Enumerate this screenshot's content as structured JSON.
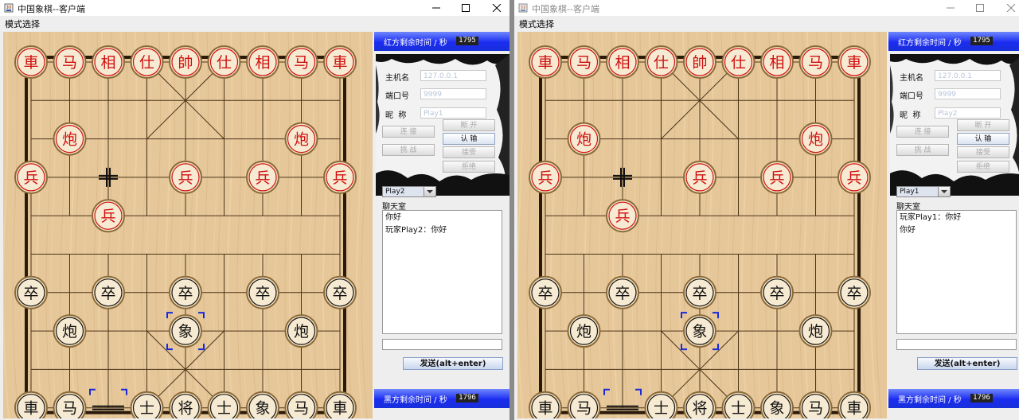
{
  "windows": [
    {
      "title": "中国象棋--客户端",
      "menu": "模式选择",
      "red_timer": {
        "label": "红方剩余时间 / 秒",
        "value": "1795"
      },
      "black_timer": {
        "label": "黑方剩余时间 / 秒",
        "value": "1796"
      },
      "host_label": "主机名",
      "host_value": "127.0.0.1",
      "port_label": "端口号",
      "port_value": "9999",
      "nick_label": "昵  称",
      "nick_value": "Play1",
      "buttons": {
        "connect": "连 接",
        "disconnect": "断 开",
        "challenge": "挑 战",
        "resign": "认 输",
        "accept": "接受",
        "reject": "拒绝"
      },
      "opponent_select": "Play2",
      "chat_title": "聊天室",
      "chat_lines": [
        "你好",
        "玩家Play2：你好"
      ],
      "send_button": "发送(alt+enter)"
    },
    {
      "title": "中国象棋--客户端",
      "menu": "模式选择",
      "red_timer": {
        "label": "红方剩余时间 / 秒",
        "value": "1795"
      },
      "black_timer": {
        "label": "黑方剩余时间 / 秒",
        "value": "1796"
      },
      "host_label": "主机名",
      "host_value": "127.0.0.1",
      "port_label": "端口号",
      "port_value": "9999",
      "nick_label": "昵  称",
      "nick_value": "Play2",
      "buttons": {
        "connect": "连 接",
        "disconnect": "断 开",
        "challenge": "挑 战",
        "resign": "认 输",
        "accept": "接受",
        "reject": "拒绝"
      },
      "opponent_select": "Play1",
      "chat_title": "聊天室",
      "chat_lines": [
        "玩家Play1：你好",
        "你好"
      ],
      "send_button": "发送(alt+enter)"
    }
  ],
  "board": {
    "colors": {
      "wood": "#e6c79a",
      "red_piece": "#d01010",
      "black_piece": "#111111",
      "selection": "#1a2ad8"
    },
    "pieces": [
      {
        "side": "red",
        "label": "車",
        "file": 0,
        "rank": 0
      },
      {
        "side": "red",
        "label": "马",
        "file": 1,
        "rank": 0
      },
      {
        "side": "red",
        "label": "相",
        "file": 2,
        "rank": 0
      },
      {
        "side": "red",
        "label": "仕",
        "file": 3,
        "rank": 0
      },
      {
        "side": "red",
        "label": "帥",
        "file": 4,
        "rank": 0
      },
      {
        "side": "red",
        "label": "仕",
        "file": 5,
        "rank": 0
      },
      {
        "side": "red",
        "label": "相",
        "file": 6,
        "rank": 0
      },
      {
        "side": "red",
        "label": "马",
        "file": 7,
        "rank": 0
      },
      {
        "side": "red",
        "label": "車",
        "file": 8,
        "rank": 0
      },
      {
        "side": "red",
        "label": "炮",
        "file": 1,
        "rank": 2
      },
      {
        "side": "red",
        "label": "炮",
        "file": 7,
        "rank": 2
      },
      {
        "side": "red",
        "label": "兵",
        "file": 0,
        "rank": 3
      },
      {
        "side": "red",
        "label": "兵",
        "file": 4,
        "rank": 3
      },
      {
        "side": "red",
        "label": "兵",
        "file": 6,
        "rank": 3
      },
      {
        "side": "red",
        "label": "兵",
        "file": 8,
        "rank": 3
      },
      {
        "side": "red",
        "label": "兵",
        "file": 2,
        "rank": 4
      },
      {
        "side": "black",
        "label": "卒",
        "file": 0,
        "rank": 6
      },
      {
        "side": "black",
        "label": "卒",
        "file": 2,
        "rank": 6
      },
      {
        "side": "black",
        "label": "卒",
        "file": 4,
        "rank": 6
      },
      {
        "side": "black",
        "label": "卒",
        "file": 6,
        "rank": 6
      },
      {
        "side": "black",
        "label": "卒",
        "file": 8,
        "rank": 6
      },
      {
        "side": "black",
        "label": "炮",
        "file": 1,
        "rank": 7
      },
      {
        "side": "black",
        "label": "象",
        "file": 4,
        "rank": 7
      },
      {
        "side": "black",
        "label": "炮",
        "file": 7,
        "rank": 7
      },
      {
        "side": "black",
        "label": "車",
        "file": 0,
        "rank": 9
      },
      {
        "side": "black",
        "label": "马",
        "file": 1,
        "rank": 9
      },
      {
        "side": "black",
        "label": "士",
        "file": 3,
        "rank": 9
      },
      {
        "side": "black",
        "label": "将",
        "file": 4,
        "rank": 9
      },
      {
        "side": "black",
        "label": "士",
        "file": 5,
        "rank": 9
      },
      {
        "side": "black",
        "label": "象",
        "file": 6,
        "rank": 9
      },
      {
        "side": "black",
        "label": "马",
        "file": 7,
        "rank": 9
      },
      {
        "side": "black",
        "label": "車",
        "file": 8,
        "rank": 9
      }
    ],
    "selected": {
      "file": 4,
      "rank": 7
    },
    "last_move_from": {
      "file": 2,
      "rank": 9
    },
    "cursor_mark": {
      "file": 2,
      "rank": 3
    }
  }
}
